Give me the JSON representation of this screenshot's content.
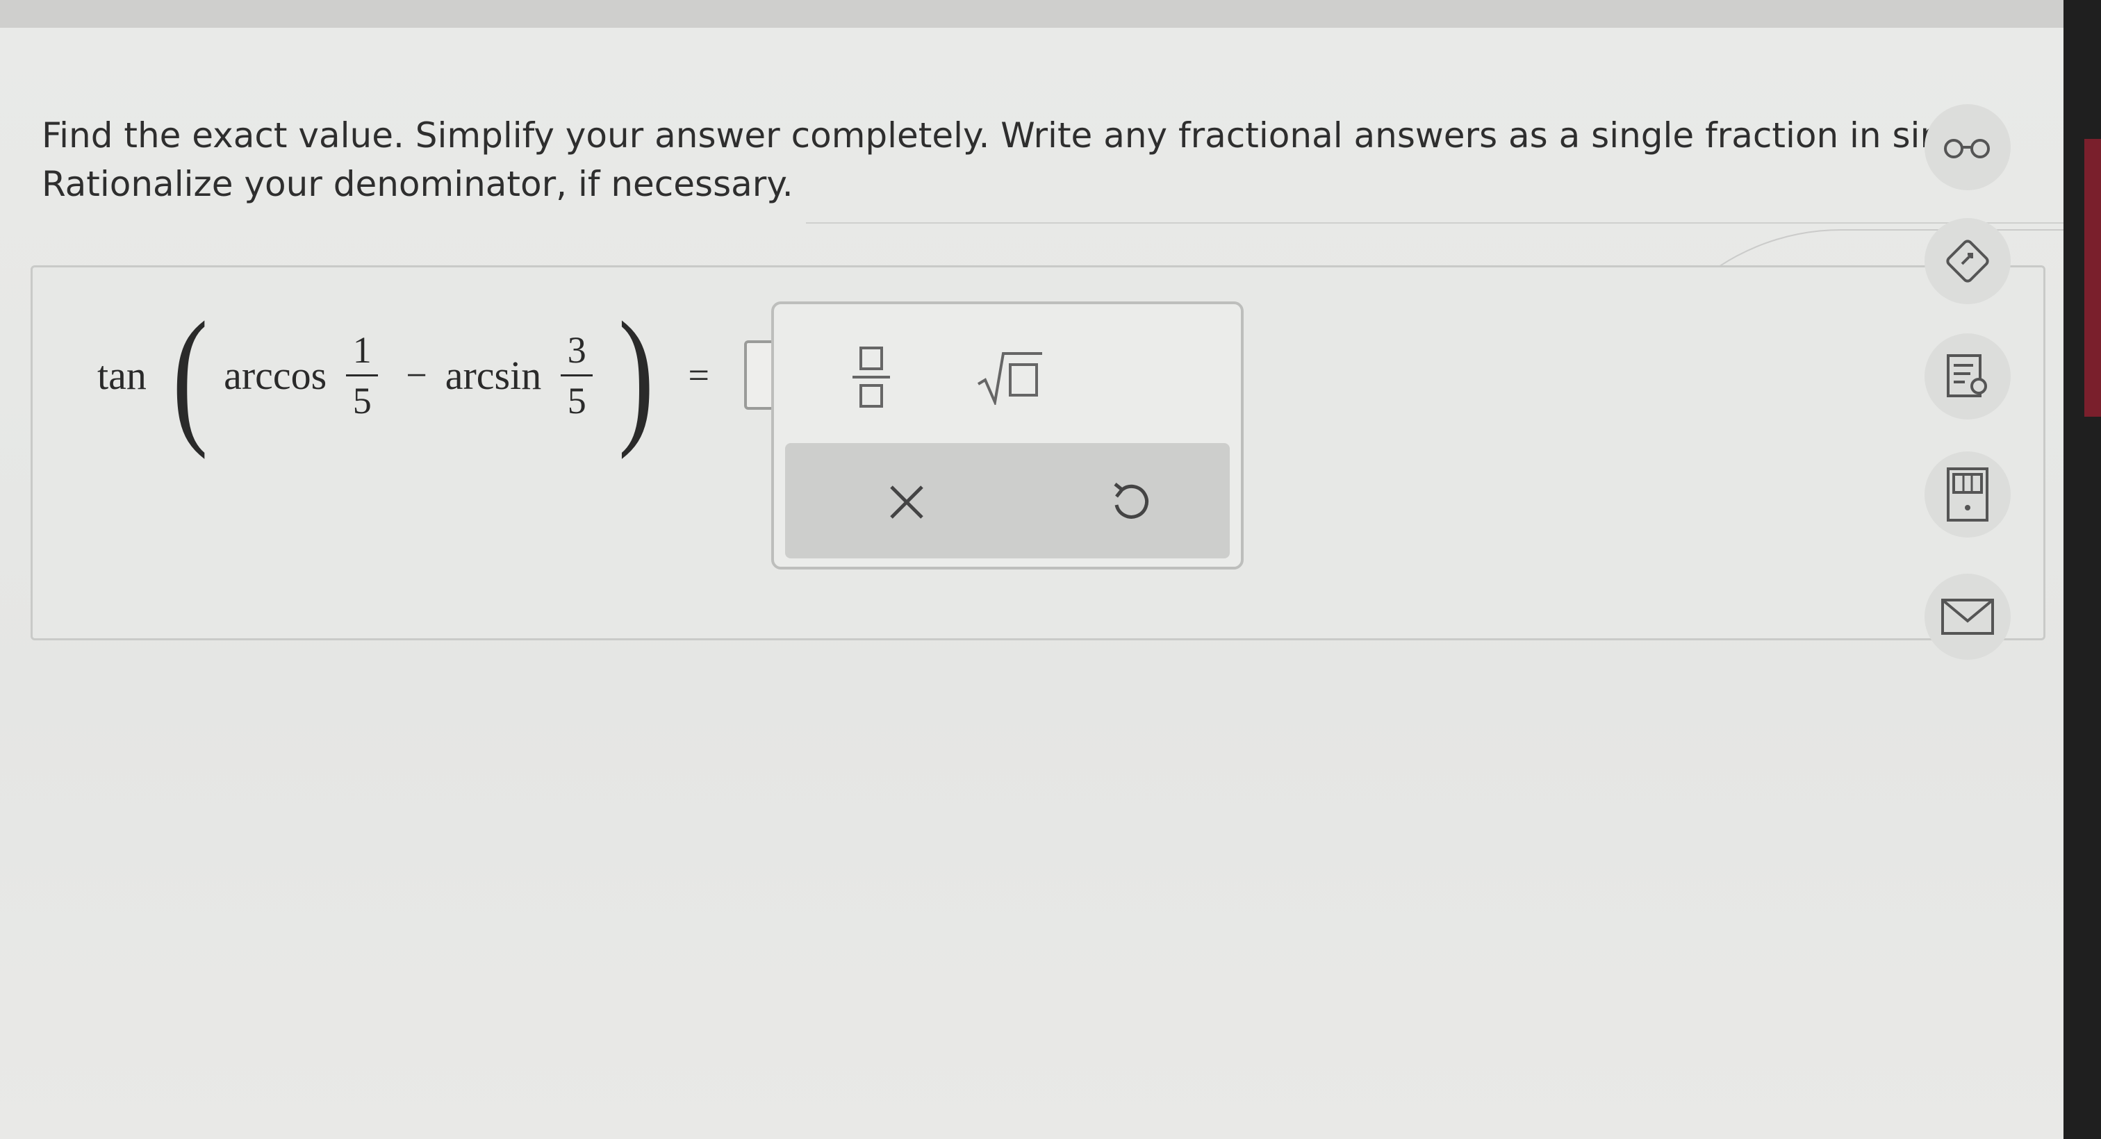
{
  "instructions": {
    "line1": "Find the exact value. Simplify your answer completely. Write any fractional answers as a single fraction in simple",
    "line2": "Rationalize your denominator, if necessary."
  },
  "expression": {
    "func": "tan",
    "arccos_label": "arccos",
    "frac1": {
      "numerator": "1",
      "denominator": "5"
    },
    "minus": "−",
    "arcsin_label": "arcsin",
    "frac2": {
      "numerator": "3",
      "denominator": "5"
    },
    "equals": "=",
    "open_paren": "(",
    "close_paren": ")"
  },
  "answer": {
    "value": ""
  },
  "palette": {
    "fraction_tool": "fraction-template",
    "sqrt_tool": "square-root-template",
    "clear_symbol": "×",
    "undo_symbol": "↺"
  },
  "side_icons": [
    "glasses-icon",
    "edit-tag-icon",
    "textbook-icon",
    "calculator-icon",
    "mail-icon"
  ]
}
